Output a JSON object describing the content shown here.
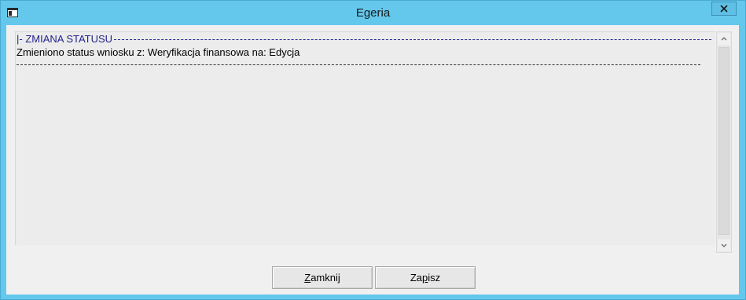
{
  "window": {
    "title": "Egeria"
  },
  "memo": {
    "header_text": "|- ZMIANA STATUSU",
    "status_text": "Zmieniono status wniosku z: Weryfikacja finansowa na:  Edycja"
  },
  "buttons": {
    "close": {
      "mnemonic": "Z",
      "rest": "amknij"
    },
    "save": {
      "pre": "Za",
      "mnemonic": "p",
      "rest": "isz"
    }
  },
  "colors": {
    "titlebar": "#63c8ec",
    "header_text": "#23238e",
    "client_bg": "#f0f0f0"
  },
  "icons": {
    "system_menu": "window-icon",
    "close": "close-icon",
    "scroll_up": "chevron-up-icon",
    "scroll_down": "chevron-down-icon"
  }
}
